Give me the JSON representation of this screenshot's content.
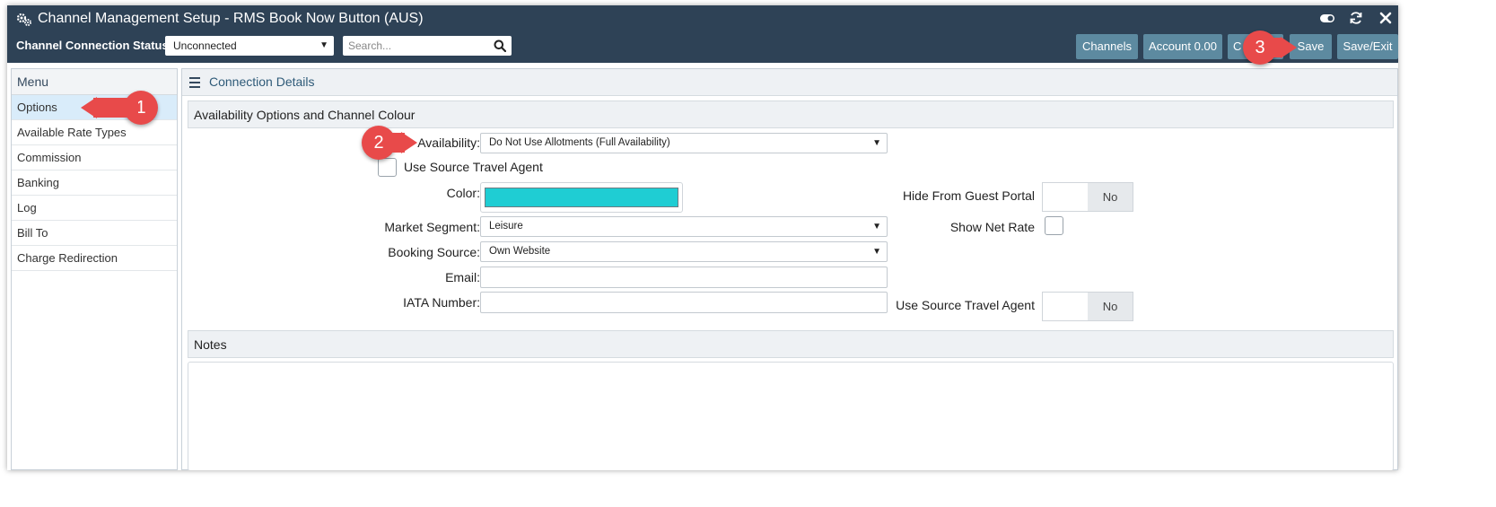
{
  "window": {
    "title": "Channel Management Setup - RMS Book Now Button (AUS)",
    "icons": [
      "gears-icon",
      "toggle-icon",
      "refresh-icon",
      "close-icon"
    ]
  },
  "toolbar": {
    "status_label": "Channel Connection Status:",
    "status_value": "Unconnected",
    "search_placeholder": "Search...",
    "buttons": {
      "channels": "Channels",
      "account": "Account 0.00",
      "other": "C",
      "save": "Save",
      "save_exit": "Save/Exit"
    }
  },
  "menu": {
    "title": "Menu",
    "items": [
      "Options",
      "Available Rate Types",
      "Commission",
      "Banking",
      "Log",
      "Bill To",
      "Charge Redirection"
    ],
    "active": "Options"
  },
  "main": {
    "header": "Connection Details",
    "availability_section": "Availability Options and Channel Colour",
    "fields": {
      "availability_label": "Availability:",
      "availability_value": "Do Not Use Allotments (Full Availability)",
      "use_source_ta_label": "Use Source Travel Agent",
      "color_label": "Color:",
      "color_value": "#1fcdd3",
      "market_segment_label": "Market Segment:",
      "market_segment_value": "Leisure",
      "booking_source_label": "Booking Source:",
      "booking_source_value": "Own Website",
      "email_label": "Email:",
      "iata_label": "IATA Number:",
      "hide_guest_portal_label": "Hide From Guest Portal",
      "hide_guest_portal_value": "No",
      "show_net_rate_label": "Show Net Rate",
      "use_source_ta_right_label": "Use Source Travel Agent",
      "use_source_ta_right_value": "No"
    },
    "notes_section": "Notes"
  },
  "callouts": {
    "one": "1",
    "two": "2",
    "three": "3"
  },
  "colors": {
    "titlebar": "#2e4256",
    "button": "#5d8aa0",
    "callout": "#e84a4a",
    "active_menu": "#d9ecfa"
  }
}
